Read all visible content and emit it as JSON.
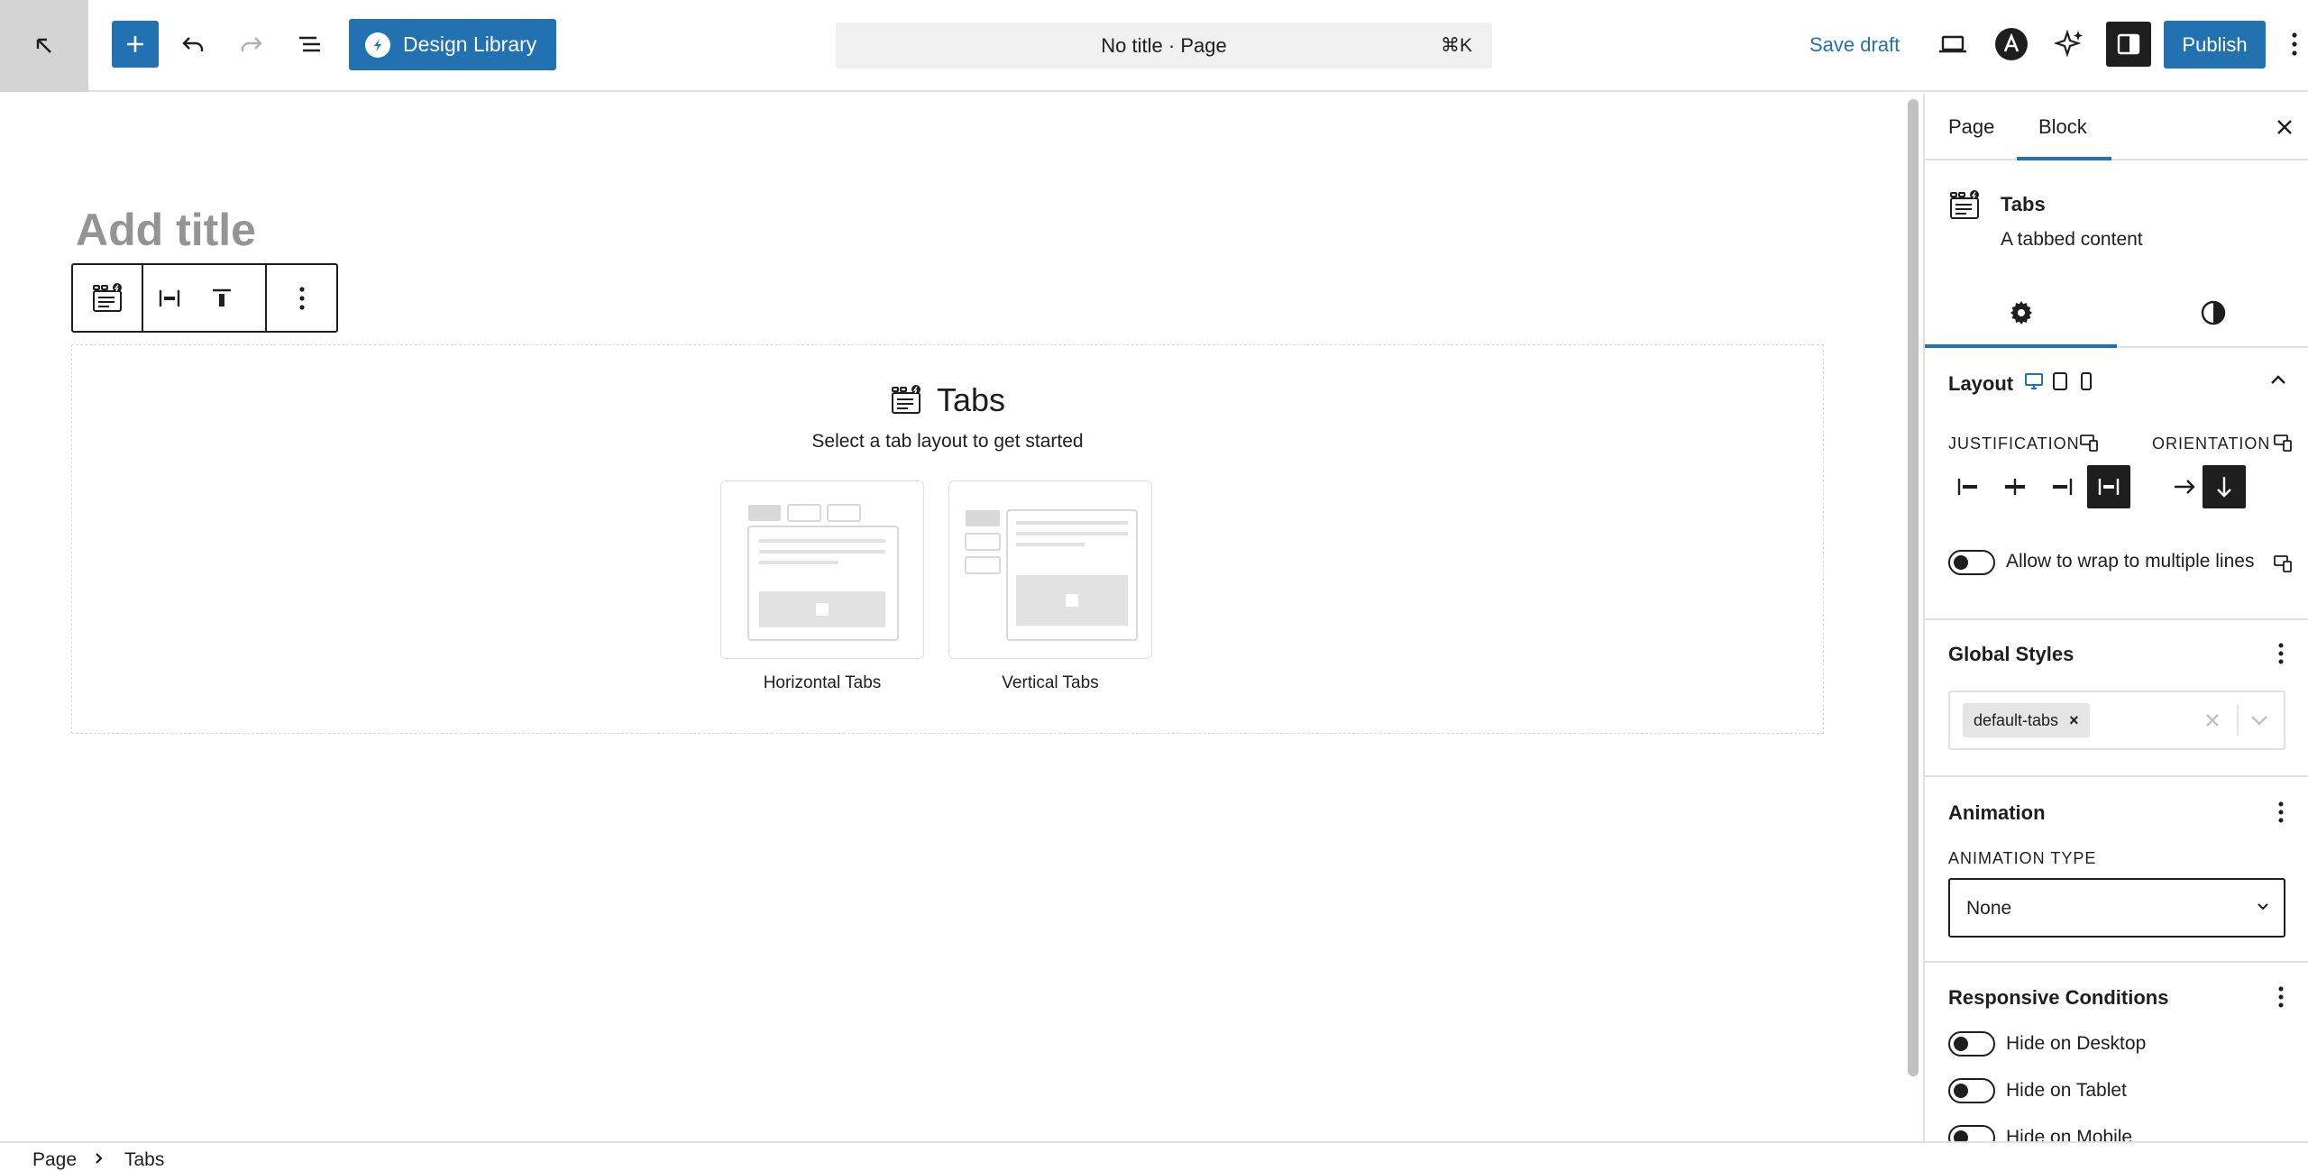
{
  "topbar": {
    "design_library_label": "Design Library",
    "document_title": "No title · Page",
    "shortcut": "⌘K",
    "save_draft_label": "Save draft",
    "publish_label": "Publish"
  },
  "editor": {
    "title_placeholder": "Add title",
    "placeholder": {
      "title": "Tabs",
      "instructions": "Select a tab layout to get started",
      "options": [
        {
          "label": "Horizontal Tabs"
        },
        {
          "label": "Vertical Tabs"
        }
      ]
    }
  },
  "breadcrumb": [
    "Page",
    "Tabs"
  ],
  "sidebar": {
    "tabs": [
      {
        "label": "Page",
        "active": false
      },
      {
        "label": "Block",
        "active": true
      }
    ],
    "block_card": {
      "title": "Tabs",
      "description": "A tabbed content"
    },
    "layout": {
      "title": "Layout",
      "justification_label": "JUSTIFICATION",
      "orientation_label": "ORIENTATION",
      "wrap_label": "Allow to wrap to multiple lines",
      "wrap_enabled": false
    },
    "global_styles": {
      "title": "Global Styles",
      "selected": [
        "default-tabs"
      ]
    },
    "animation": {
      "title": "Animation",
      "type_label": "ANIMATION TYPE",
      "value": "None"
    },
    "responsive": {
      "title": "Responsive Conditions",
      "items": [
        {
          "label": "Hide on Desktop",
          "enabled": false
        },
        {
          "label": "Hide on Tablet",
          "enabled": false
        },
        {
          "label": "Hide on Mobile",
          "enabled": false
        }
      ]
    }
  },
  "colors": {
    "accent": "#2271b1",
    "dark": "#1e1e1e",
    "border": "#e0e0e0",
    "placeholder_text": "#949494"
  }
}
